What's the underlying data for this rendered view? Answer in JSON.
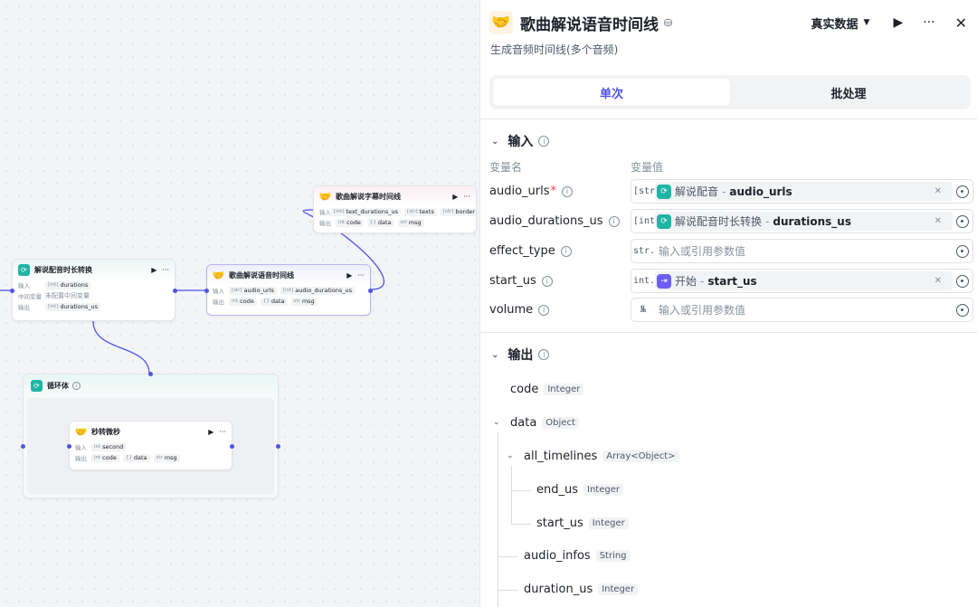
{
  "canvas": {
    "node_convert": {
      "title": "解说配音时长转换",
      "in_label": "输入",
      "in_chip_type": "[int]",
      "in_chip": "durations",
      "mid_label": "中间变量",
      "mid_value": "未配置中间变量",
      "out_label": "输出",
      "out_chip_type": "[int]",
      "out_chip": "durations_us"
    },
    "node_timeline": {
      "title": "歌曲解说语音时间线",
      "in_label": "输入",
      "in1_type": "[str]",
      "in1": "audio_urls",
      "in2_type": "[int]",
      "in2": "audio_durations_us",
      "out_label": "输出",
      "out1_type": "int",
      "out1": "code",
      "out2_type": "{}",
      "out2": "data",
      "out3_type": "str",
      "out3": "msg"
    },
    "node_subtitle": {
      "title": "歌曲解说字幕时间线",
      "in_label": "输入",
      "in1_type": "[int]",
      "in1": "text_durations_us",
      "in2_type": "[str]",
      "in2": "texts",
      "in3_type": "[str]",
      "in3": "border",
      "out_label": "输出",
      "out1_type": "int",
      "out1": "code",
      "out2_type": "{}",
      "out2": "data",
      "out3_type": "str",
      "out3": "msg"
    },
    "loop": {
      "title": "循环体"
    },
    "node_sec": {
      "title": "秒转微秒",
      "in_label": "输入",
      "in_type": "int",
      "in": "second",
      "out_label": "输出",
      "out1_type": "int",
      "out1": "code",
      "out2_type": "{}",
      "out2": "data",
      "out3_type": "str",
      "out3": "msg"
    },
    "play_glyph": "▶",
    "more_glyph": "···"
  },
  "panel": {
    "title": "歌曲解说语音时间线",
    "data_mode": "真实数据",
    "description": "生成音频时间线(多个音频)",
    "tabs": [
      {
        "label": "单次"
      },
      {
        "label": "批处理"
      }
    ],
    "inputs_heading": "输入",
    "col_name": "变量名",
    "col_value": "变量值",
    "params": [
      {
        "name": "audio_urls",
        "type": "[str]",
        "ref_node": "解说配音",
        "ref_var": "audio_urls"
      },
      {
        "name": "audio_durations_us",
        "type": "[int]",
        "ref_node": "解说配音时长转换",
        "ref_var": "durations_us"
      },
      {
        "name": "effect_type",
        "type": "str.",
        "placeholder": "输入或引用参数值"
      },
      {
        "name": "start_us",
        "type": "int.",
        "ref_node": "开始",
        "ref_var": "start_us"
      },
      {
        "name": "volume",
        "type": "№",
        "placeholder": "输入或引用参数值"
      }
    ],
    "outputs_heading": "输出",
    "outputs": [
      {
        "name": "code",
        "type": "Integer"
      },
      {
        "name": "data",
        "type": "Object"
      },
      {
        "name": "all_timelines",
        "type": "Array<Object>"
      },
      {
        "name": "end_us",
        "type": "Integer"
      },
      {
        "name": "start_us",
        "type": "Integer"
      },
      {
        "name": "audio_infos",
        "type": "String"
      },
      {
        "name": "duration_us",
        "type": "Integer"
      }
    ]
  },
  "colors": {
    "accent": "#4d53e8",
    "teal": "#1fb5a5",
    "purple": "#6b5ef7",
    "required": "#f53f3f"
  },
  "icons": {
    "node_emoji": "handshake-icon",
    "loop_icon": "loop-icon",
    "start_icon": "start-icon"
  }
}
